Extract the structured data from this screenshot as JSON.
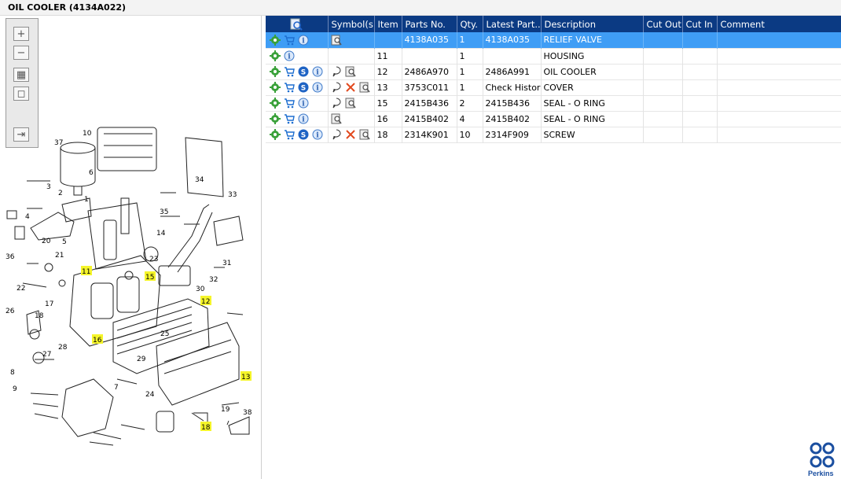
{
  "window": {
    "title": "OIL COOLER (4134A022)"
  },
  "zoom_toolbar": {
    "buttons": [
      {
        "name": "zoom-in-button",
        "glyph": "+"
      },
      {
        "name": "zoom-out-button",
        "glyph": "−"
      },
      {
        "name": "fit-all-button",
        "glyph": "▦"
      },
      {
        "name": "actual-size-button",
        "glyph": "◻"
      },
      {
        "name": "export-button",
        "glyph": "⇥"
      }
    ]
  },
  "diagram": {
    "callouts": [
      "10",
      "37",
      "6",
      "1",
      "3",
      "2",
      "4",
      "5",
      "20",
      "21",
      "36",
      "22",
      "11",
      "17",
      "26",
      "18",
      "19",
      "13",
      "12",
      "15",
      "16",
      "28",
      "27",
      "8",
      "9",
      "7",
      "24",
      "29",
      "38",
      "33",
      "34",
      "35",
      "30",
      "31",
      "32",
      "23",
      "14",
      "25"
    ],
    "highlighted": [
      "11",
      "12",
      "13",
      "15",
      "16",
      "18"
    ]
  },
  "parts_table": {
    "columns": [
      "",
      "Symbol(s)",
      "Item",
      "Parts No.",
      "Qty.",
      "Latest Part...",
      "Description",
      "Cut Out",
      "Cut In",
      "Comment"
    ],
    "rows": [
      {
        "icons": [
          "gear-icon",
          "cart-icon",
          "info-icon"
        ],
        "symbols": [
          "magnify-book-icon"
        ],
        "item": "",
        "part_no": "4138A035",
        "qty": "1",
        "latest": "4138A035",
        "description": "RELIEF VALVE",
        "cut_out": "",
        "cut_in": "",
        "comment": "",
        "selected": true
      },
      {
        "icons": [
          "gear-icon",
          "info-icon"
        ],
        "symbols": [],
        "item": "11",
        "part_no": "",
        "qty": "1",
        "latest": "",
        "description": "HOUSING",
        "cut_out": "",
        "cut_in": "",
        "comment": "",
        "selected": false
      },
      {
        "icons": [
          "gear-icon",
          "cart-icon",
          "service-icon",
          "info-icon"
        ],
        "symbols": [
          "bubble-icon",
          "magnify-book-icon"
        ],
        "item": "12",
        "part_no": "2486A970",
        "qty": "1",
        "latest": "2486A991",
        "description": "OIL COOLER",
        "cut_out": "",
        "cut_in": "",
        "comment": "",
        "selected": false
      },
      {
        "icons": [
          "gear-icon",
          "cart-icon",
          "service-icon",
          "info-icon"
        ],
        "symbols": [
          "bubble-icon",
          "cross-icon",
          "magnify-book-icon"
        ],
        "item": "13",
        "part_no": "3753C011",
        "qty": "1",
        "latest": "Check History",
        "description": "COVER",
        "cut_out": "",
        "cut_in": "",
        "comment": "",
        "selected": false
      },
      {
        "icons": [
          "gear-icon",
          "cart-icon",
          "info-icon"
        ],
        "symbols": [
          "bubble-icon",
          "magnify-book-icon"
        ],
        "item": "15",
        "part_no": "2415B436",
        "qty": "2",
        "latest": "2415B436",
        "description": "SEAL - O RING",
        "cut_out": "",
        "cut_in": "",
        "comment": "",
        "selected": false
      },
      {
        "icons": [
          "gear-icon",
          "cart-icon",
          "info-icon"
        ],
        "symbols": [
          "magnify-book-icon"
        ],
        "item": "16",
        "part_no": "2415B402",
        "qty": "4",
        "latest": "2415B402",
        "description": "SEAL - O RING",
        "cut_out": "",
        "cut_in": "",
        "comment": "",
        "selected": false
      },
      {
        "icons": [
          "gear-icon",
          "cart-icon",
          "service-icon",
          "info-icon"
        ],
        "symbols": [
          "bubble-icon",
          "cross-icon",
          "magnify-book-icon"
        ],
        "item": "18",
        "part_no": "2314K901",
        "qty": "10",
        "latest": "2314F909",
        "description": "SCREW",
        "cut_out": "",
        "cut_in": "",
        "comment": "",
        "selected": false
      }
    ]
  },
  "brand": {
    "name": "Perkins",
    "color": "#1b4fa0"
  },
  "colors": {
    "header": "#0b3a83",
    "selection": "#3f9df5",
    "highlight": "#f5f52a"
  }
}
